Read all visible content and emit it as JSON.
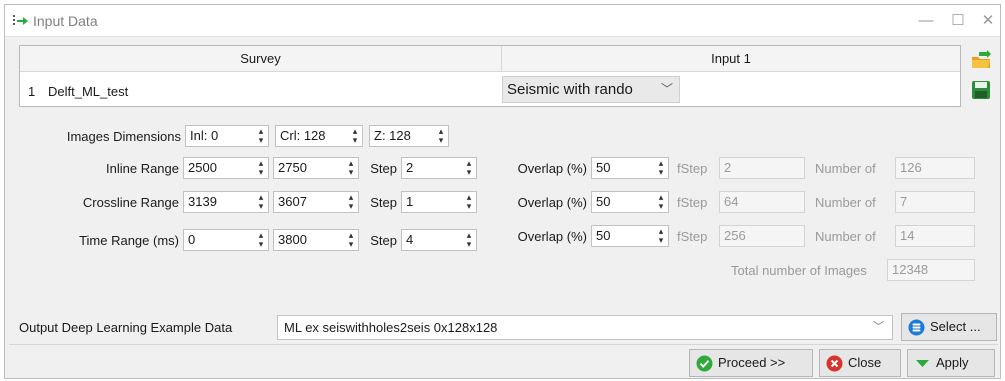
{
  "window": {
    "title": "Input Data",
    "minimize": "—",
    "maximize": "☐",
    "close": "✕"
  },
  "table": {
    "headers": [
      "Survey",
      "Input 1"
    ],
    "rows": [
      {
        "num": "1",
        "survey": "Delft_ML_test",
        "input": "Seismic with rando"
      }
    ]
  },
  "images_dimensions": {
    "label": "Images Dimensions",
    "inl": "Inl: 0",
    "crl": "Crl: 128",
    "z": "Z: 128"
  },
  "ranges": [
    {
      "label": "Inline Range",
      "from": "2500",
      "to": "2750",
      "step_label": "Step",
      "step": "2",
      "overlap_label": "Overlap (%)",
      "overlap": "50",
      "fstep_label": "fStep",
      "fstep": "2",
      "number_label": "Number of",
      "number": "126"
    },
    {
      "label": "Crossline Range",
      "from": "3139",
      "to": "3607",
      "step_label": "Step",
      "step": "1",
      "overlap_label": "Overlap (%)",
      "overlap": "50",
      "fstep_label": "fStep",
      "fstep": "64",
      "number_label": "Number of",
      "number": "7"
    },
    {
      "label": "Time Range (ms)",
      "from": "0",
      "to": "3800",
      "step_label": "Step",
      "step": "4",
      "overlap_label": "Overlap (%)",
      "overlap": "50",
      "fstep_label": "fStep",
      "fstep": "256",
      "number_label": "Number of",
      "number": "14"
    }
  ],
  "total": {
    "label": "Total number of Images",
    "value": "12348"
  },
  "output": {
    "label": "Output Deep Learning Example Data",
    "value": "ML  ex  seiswithholes2seis  0x128x128",
    "select_label": "Select ..."
  },
  "buttons": {
    "proceed": "Proceed >>",
    "close": "Close",
    "apply": "Apply"
  },
  "colors": {
    "accent_green": "#2eaa3c",
    "close_red": "#d9342b",
    "select_blue": "#1f7ad6"
  },
  "icons": {
    "title": "input-arrow-icon",
    "open": "open-folder-icon",
    "save": "save-disk-icon",
    "select": "database-icon",
    "proceed": "check-circle-icon",
    "close": "close-circle-icon",
    "apply": "green-triangle-icon"
  }
}
